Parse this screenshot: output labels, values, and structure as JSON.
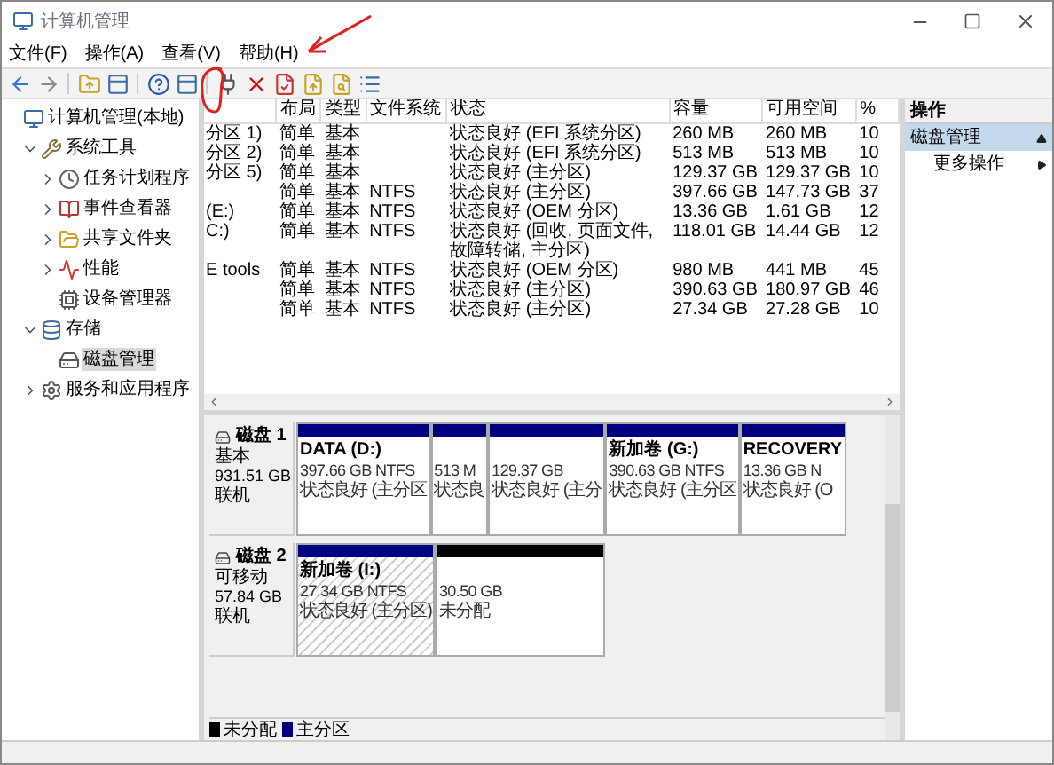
{
  "window": {
    "title": "计算机管理"
  },
  "menu": [
    "文件(F)",
    "操作(A)",
    "查看(V)",
    "帮助(H)"
  ],
  "tree": [
    {
      "label": "计算机管理(本地)",
      "selected": false,
      "children": [
        {
          "label": "系统工具",
          "expanded": true,
          "selected": false,
          "children": [
            {
              "label": "任务计划程序",
              "expanded": false,
              "selected": false
            },
            {
              "label": "事件查看器",
              "expanded": false,
              "selected": false
            },
            {
              "label": "共享文件夹",
              "expanded": false,
              "selected": false
            },
            {
              "label": "性能",
              "expanded": false,
              "selected": false
            },
            {
              "label": "设备管理器",
              "selected": false
            }
          ]
        },
        {
          "label": "存储",
          "expanded": true,
          "selected": false,
          "children": [
            {
              "label": "磁盘管理",
              "selected": true
            }
          ]
        },
        {
          "label": "服务和应用程序",
          "expanded": false,
          "selected": false
        }
      ]
    }
  ],
  "volume_table": {
    "columns": [
      "布局",
      "类型",
      "文件系统",
      "状态",
      "容量",
      "可用空间",
      "%"
    ],
    "rows": [
      {
        "column_1": "分区 1)",
        "layout": "简单",
        "type": "基本",
        "status": "状态良好 (EFI 系统分区)",
        "capacity": "260 MB",
        "free_space": "260 MB",
        "percent": "10"
      },
      {
        "column_1": "分区 2)",
        "layout": "简单",
        "type": "基本",
        "status": "状态良好 (EFI 系统分区)",
        "capacity": "513 MB",
        "free_space": "513 MB",
        "percent": "10"
      },
      {
        "column_1": "分区 5)",
        "layout": "简单",
        "type": "基本",
        "status": "状态良好 (主分区)",
        "capacity": "129.37 GB",
        "free_space": "129.37 GB",
        "percent": "10"
      },
      {
        "layout": "简单",
        "type": "基本",
        "file_system": "NTFS",
        "status": "状态良好 (主分区)",
        "capacity": "397.66 GB",
        "free_space": "147.73 GB",
        "percent": "37"
      },
      {
        "column_1": "(E:)",
        "layout": "简单",
        "type": "基本",
        "file_system": "NTFS",
        "status": "状态良好 (OEM 分区)",
        "capacity": "13.36 GB",
        "free_space": "1.61 GB",
        "percent": "12"
      },
      {
        "column_1": "C:)",
        "layout": "简单",
        "type": "基本",
        "file_system": "NTFS",
        "status": "状态良好 (回收, 页面文件, 故障转储, 主分区)",
        "capacity": "118.01 GB",
        "free_space": "14.44 GB",
        "percent": "12"
      },
      {
        "column_1": "E tools",
        "layout": "简单",
        "type": "基本",
        "file_system": "NTFS",
        "status": "状态良好 (OEM 分区)",
        "capacity": "980 MB",
        "free_space": "441 MB",
        "percent": "45"
      },
      {
        "layout": "简单",
        "type": "基本",
        "file_system": "NTFS",
        "status": "状态良好 (主分区)",
        "capacity": "390.63 GB",
        "free_space": "180.97 GB",
        "percent": "46"
      },
      {
        "layout": "简单",
        "type": "基本",
        "file_system": "NTFS",
        "status": "状态良好 (主分区)",
        "capacity": "27.34 GB",
        "free_space": "27.28 GB",
        "percent": "10"
      }
    ]
  },
  "disks": [
    {
      "name": "磁盘 1",
      "type": "基本",
      "size": "931.51 GB",
      "status": "联机",
      "partitions": [
        {
          "kind": "primary",
          "selected": false,
          "label": "DATA (D:)",
          "size": "397.66 GB NTFS",
          "status": "状态良好 (主分区"
        },
        {
          "kind": "primary",
          "selected": false,
          "size": "513 M",
          "status": "状态良"
        },
        {
          "kind": "primary",
          "selected": false,
          "size": "129.37 GB",
          "status": "状态良好 (主分"
        },
        {
          "kind": "primary",
          "selected": false,
          "label": "新加卷 (G:)",
          "size": "390.63 GB NTFS",
          "status": "状态良好 (主分区"
        },
        {
          "kind": "primary",
          "selected": false,
          "label": "RECOVERY",
          "size": "13.36 GB N",
          "status": "状态良好 (O"
        }
      ]
    },
    {
      "name": "磁盘 2",
      "type": "可移动",
      "size": "57.84 GB",
      "status": "联机",
      "partitions": [
        {
          "kind": "primary",
          "selected": true,
          "label": "新加卷 (I:)",
          "size": "27.34 GB NTFS",
          "status": "状态良好 (主分区)"
        },
        {
          "kind": "unallocated",
          "selected": false,
          "size": "30.50 GB",
          "status": "未分配"
        }
      ]
    }
  ],
  "legend": [
    {
      "kind": "unallocated",
      "label": "未分配"
    },
    {
      "kind": "primary",
      "label": "主分区"
    }
  ],
  "actions": {
    "title": "操作",
    "sections": [
      {
        "label": "磁盘管理",
        "expanded": true,
        "items": [
          {
            "label": "更多操作"
          }
        ]
      }
    ]
  }
}
